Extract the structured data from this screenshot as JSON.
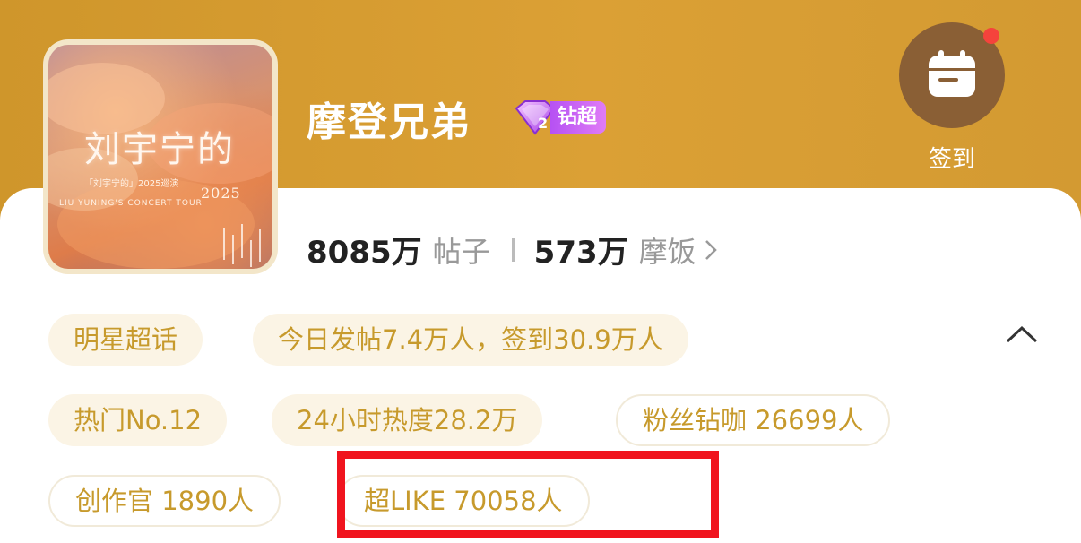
{
  "cover": {
    "title_art": "刘宇宁的",
    "subtitle_art": "「刘宇宁的」2025巡演",
    "tour_art": "LIU YUNING'S CONCERT TOUR",
    "year_art": "2025"
  },
  "header": {
    "title": "摩登兄弟",
    "badge_level": "2",
    "badge_label": "钻超",
    "checkin_label": "签到",
    "checkin_has_notification": true
  },
  "stats": {
    "posts_value": "8085万",
    "posts_label": "帖子",
    "fans_value": "573万",
    "fans_label": "摩饭"
  },
  "tags": {
    "category": "明星超话",
    "today": "今日发帖7.4万人，签到30.9万人",
    "rank": "热门No.12",
    "heat": "24小时热度28.2万",
    "diamond_fans": "粉丝钻咖 26699人",
    "creators": "创作官 1890人",
    "super_like": "超LIKE 70058人"
  },
  "colors": {
    "header_bg": "#d39a32",
    "tag_text": "#c79a2c",
    "highlight": "#f0141e",
    "checkin_btn": "#8a5f35"
  }
}
